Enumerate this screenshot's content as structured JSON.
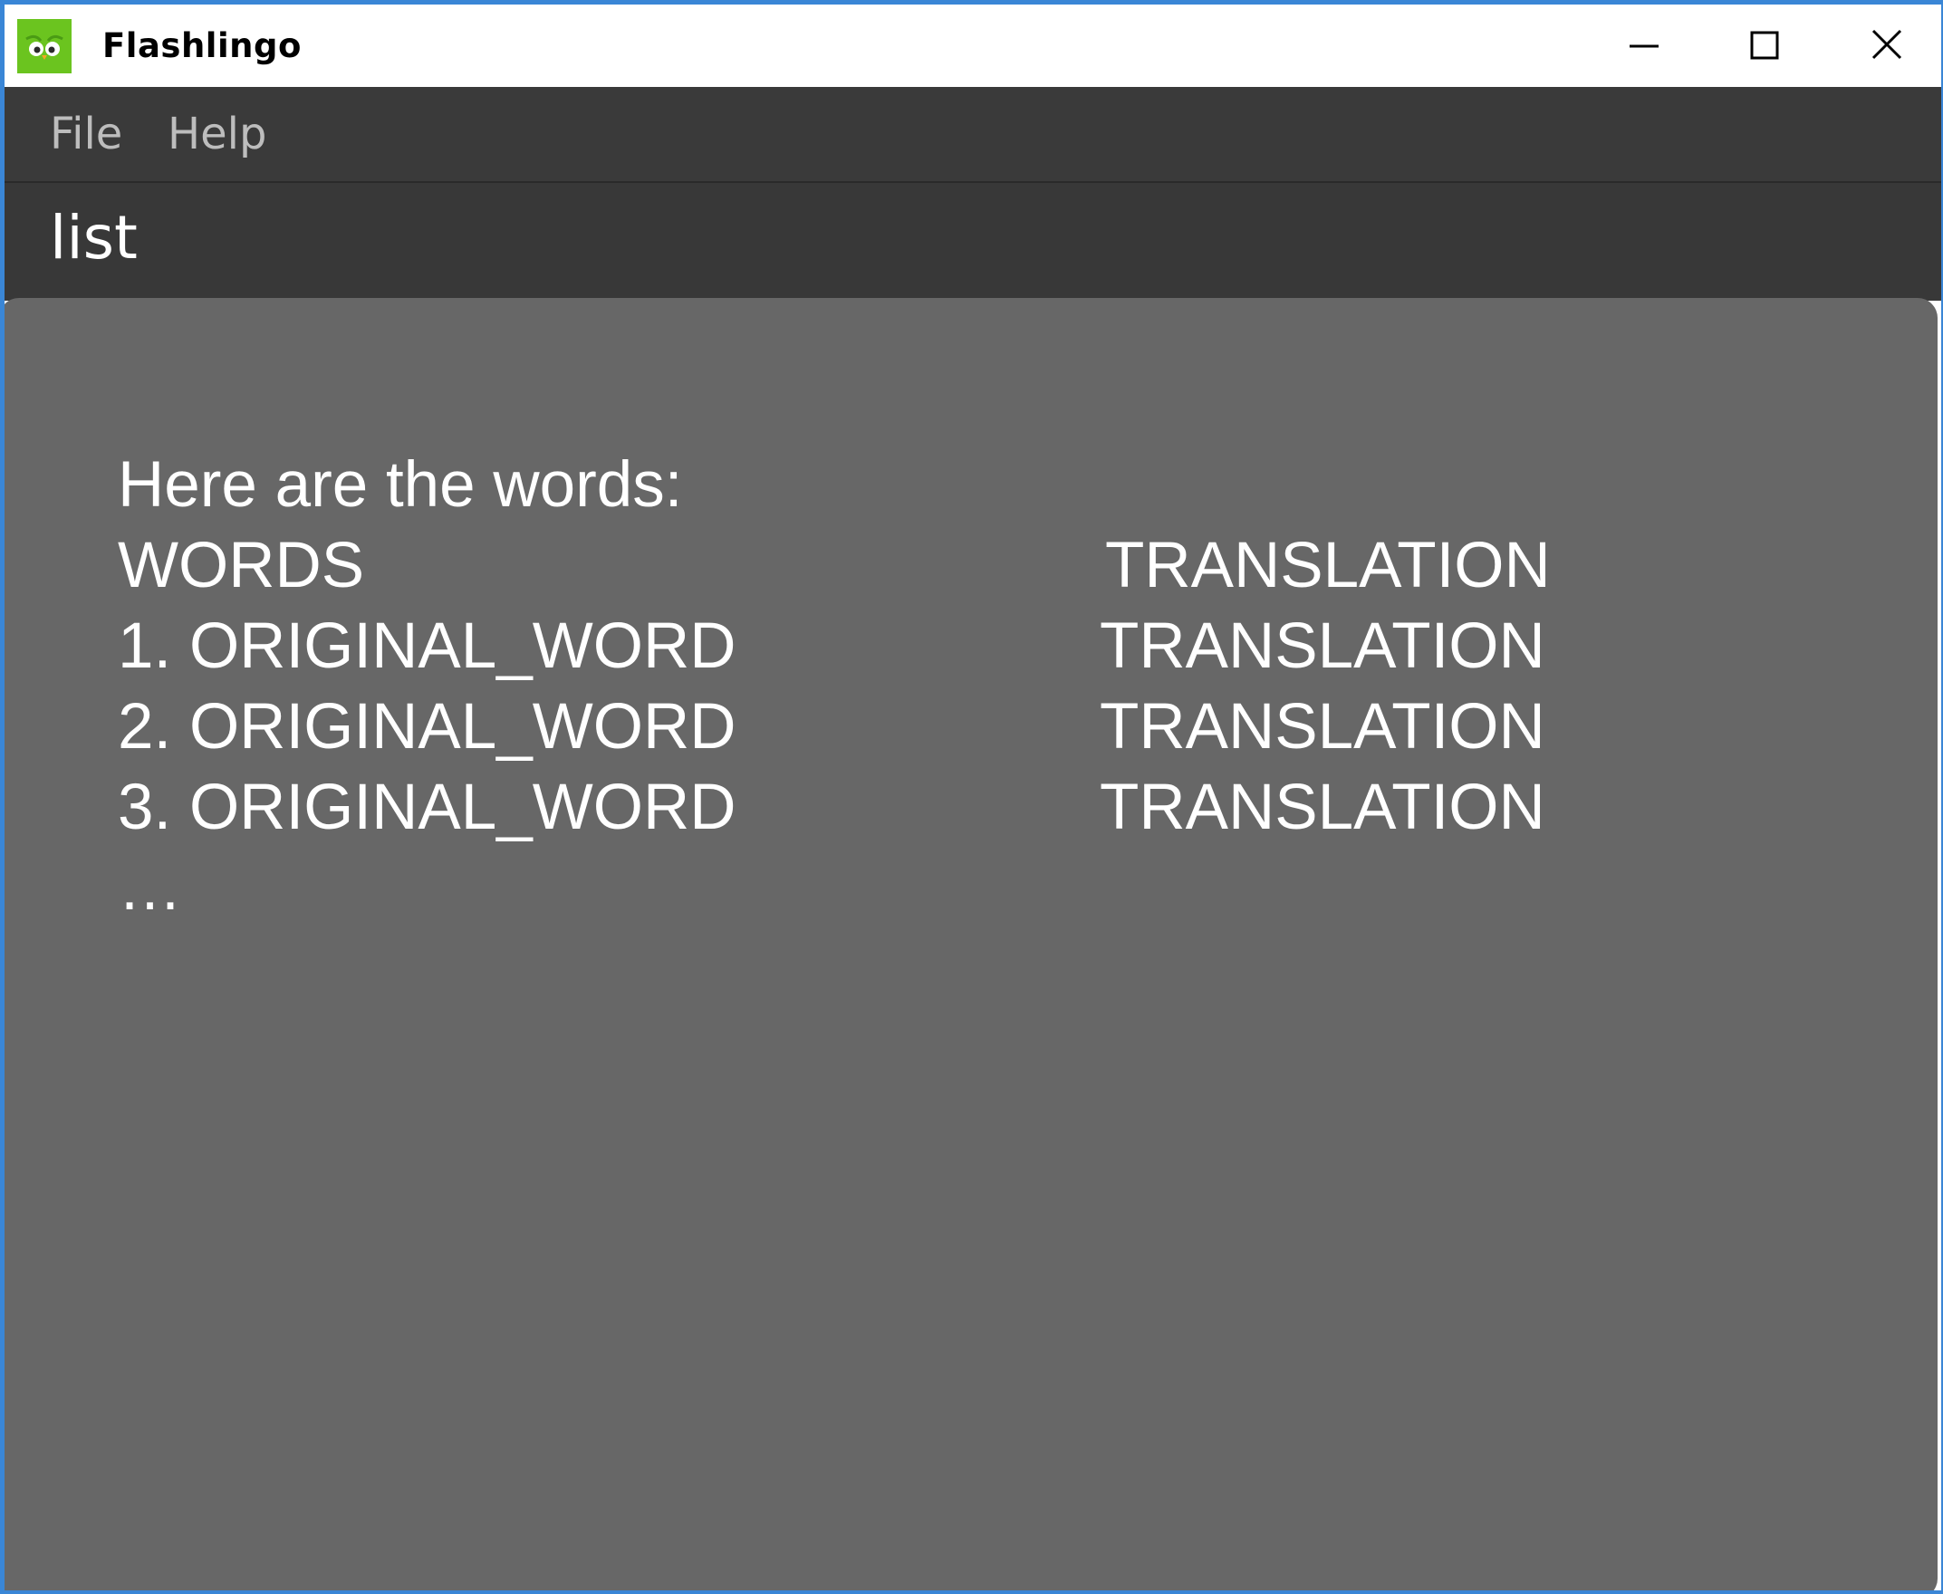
{
  "window": {
    "title": "Flashlingo",
    "icon": "owl-app-icon",
    "controls": [
      "minimize-icon",
      "maximize-icon",
      "close-icon"
    ],
    "accent_color": "#3a86d6",
    "app_icon_color": "#6bc41f"
  },
  "menubar": {
    "items": [
      {
        "label": "File"
      },
      {
        "label": "Help"
      }
    ]
  },
  "command": {
    "value": "list"
  },
  "result": {
    "intro": "Here are the words:",
    "columns": {
      "words": "WORDS",
      "translation": "TRANSLATION"
    },
    "rows": [
      {
        "word": "1. ORIGINAL_WORD",
        "translation": "TRANSLATION"
      },
      {
        "word": "2. ORIGINAL_WORD",
        "translation": "TRANSLATION"
      },
      {
        "word": "3. ORIGINAL_WORD",
        "translation": "TRANSLATION"
      }
    ],
    "more": "…"
  }
}
